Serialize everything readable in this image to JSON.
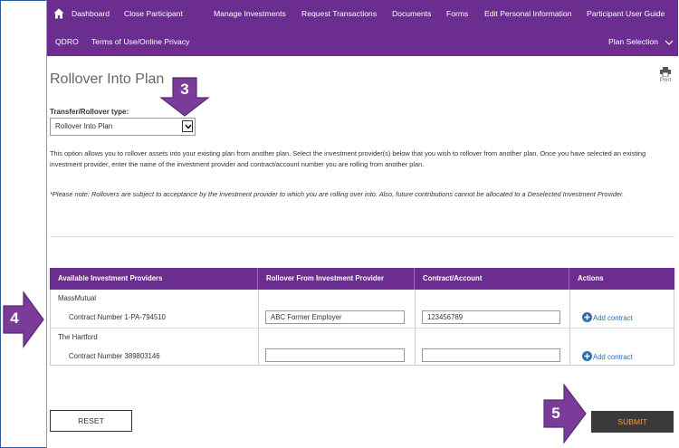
{
  "nav": {
    "row1": [
      "Dashboard",
      "Close Participant",
      "Manage Investments",
      "Request Transactions",
      "Documents",
      "Forms",
      "Edit Personal Information",
      "Participant User Guide"
    ],
    "row2": [
      "QDRO",
      "Terms of Use/Online Privacy"
    ],
    "plan_selection": "Plan Selection"
  },
  "page": {
    "title": "Rollover Into Plan",
    "print_label": "Print"
  },
  "form": {
    "type_label": "Transfer/Rollover type:",
    "type_value": "Rollover Into Plan",
    "description": "This option allows you to rollover assets into your existing plan from another plan. Select the investment provider(s) below that you wish to rollover from another plan. Once you have selected an existing investment provider, enter the name of the investment provider and contract/account number you are rolling from another plan.",
    "note": "*Please note: Rollovers are subject to acceptance by the investment provider to which you are rolling over into. Also, future contributions cannot be allocated to a Deselected Investment Provider."
  },
  "table": {
    "headers": [
      "Available Investment Providers",
      "Rollover From Investment Provider",
      "Contract/Account",
      "Actions"
    ],
    "rows": [
      {
        "provider": "MassMutual",
        "contract": "Contract Number 1-PA-794510",
        "rollover_from": "ABC Former Employer",
        "account": "123456789",
        "action": "Add contract"
      },
      {
        "provider": "The Hartford",
        "contract": "Contract Number 389803146",
        "rollover_from": "",
        "account": "",
        "action": "Add contract"
      }
    ]
  },
  "buttons": {
    "reset": "RESET",
    "submit": "SUBMIT"
  },
  "callouts": [
    "3",
    "4",
    "5"
  ],
  "colors": {
    "brand_purple": "#6b2d8f",
    "callout_purple": "#7a3c98",
    "submit_bg": "#3a3a3a",
    "submit_text": "#f0a030",
    "link_blue": "#2a6db3"
  }
}
